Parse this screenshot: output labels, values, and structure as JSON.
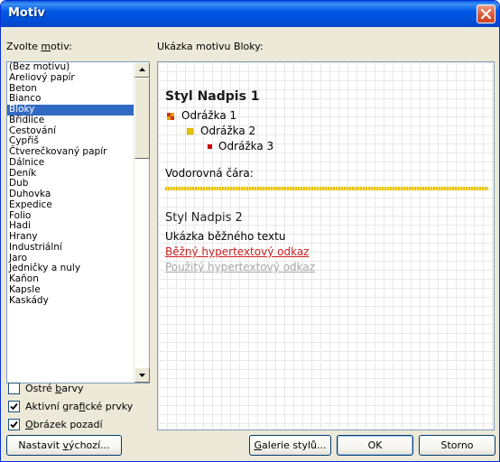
{
  "window": {
    "title": "Motiv"
  },
  "theme_list": {
    "label_prefix": "Zvolte ",
    "label_key": "m",
    "label_suffix": "otiv:",
    "items": [
      "(Bez motivu)",
      "Areliový papír",
      "Beton",
      "Bianco",
      "Bloky",
      "Břidlice",
      "Cestování",
      "Cypřiš",
      "Čtverečkovaný papír",
      "Dálnice",
      "Deník",
      "Dub",
      "Duhovka",
      "Expedice",
      "Folio",
      "Hadi",
      "Hrany",
      "Industriální",
      "Jaro",
      "Jedničky a nuly",
      "Kaňon",
      "Kapsle",
      "Kaskády"
    ],
    "selected_index": 4
  },
  "options": {
    "bright_colors": {
      "pre": "Ostré ",
      "key": "b",
      "post": "arvy",
      "checked": false
    },
    "active_graphics": {
      "pre": "Aktivní gra",
      "key": "f",
      "post": "ické prvky",
      "checked": true
    },
    "background_image": {
      "pre": "",
      "key": "O",
      "post": "brázek pozadí",
      "checked": true
    }
  },
  "preview": {
    "label": "Ukázka motivu Bloky:",
    "heading1": "Styl Nadpis 1",
    "bullet1": "Odrážka 1",
    "bullet2": "Odrážka 2",
    "bullet3": "Odrážka 3",
    "hr_label": "Vodorovná čára:",
    "heading2": "Styl Nadpis 2",
    "body_text": "Ukázka běžného textu",
    "link": "Běžný hypertextový odkaz",
    "visited_link": "Použitý hypertextový odkaz",
    "colors": {
      "bullet1": "#cc3322",
      "bullet2": "#e6c300",
      "bullet3": "#cc0000",
      "link": "#cc2222",
      "rule": "#e6c300"
    }
  },
  "buttons": {
    "set_default": {
      "pre": "Nastavit ",
      "key": "v",
      "post": "ýchozí..."
    },
    "gallery": {
      "pre": "",
      "key": "G",
      "post": "alerie stylů..."
    },
    "ok": "OK",
    "cancel": "Storno"
  }
}
